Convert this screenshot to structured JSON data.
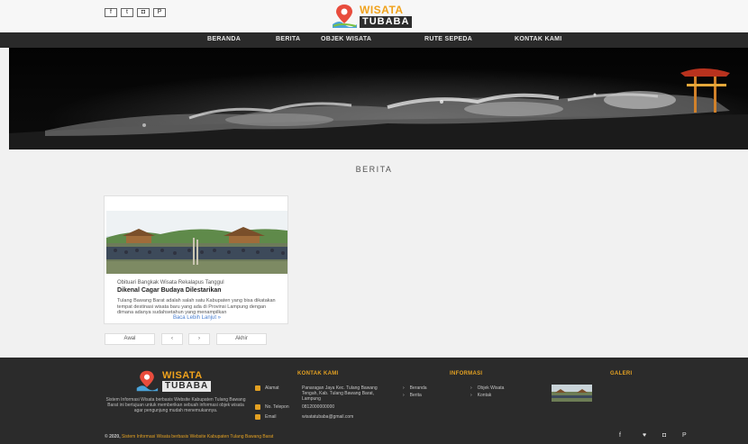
{
  "socials": [
    {
      "icon": "facebook-icon",
      "glyph": "f"
    },
    {
      "icon": "twitter-icon",
      "glyph": "t"
    },
    {
      "icon": "instagram-icon",
      "glyph": "◘"
    },
    {
      "icon": "pinterest-icon",
      "glyph": "P"
    }
  ],
  "logo": {
    "line1": "WISATA",
    "line2": "TUBABA"
  },
  "nav": [
    "BERANDA",
    "BERITA",
    "OBJEK WISATA",
    "RUTE SEPEDA",
    "KONTAK KAMI"
  ],
  "section_title": "BERITA",
  "card": {
    "title_small": "Obituari Bangkak Wisata Rekalapus Tanggul",
    "title": "Dikenal Cagar Budaya Dilestarikan",
    "text": "Tulang Bawang Barat adalah salah satu Kabupaten yang bisa dikatakan tempat destinasi wisata baru yang ada di Provinsi Lampung dengan dimana adanya sudahsetahun yang menampilkan",
    "link": "Baca Lebih Lanjut »"
  },
  "pager": {
    "first": "Awal",
    "prev": "‹",
    "next": "›",
    "last": "Akhir"
  },
  "footer": {
    "logo": {
      "line1": "WISATA",
      "line2": "TUBABA"
    },
    "description": "Sistem Informasi Wisata berbasis Website Kabupaten Tulang Bawang Barat ini bertujuan untuk memberikan sebuah informasi objek wisata agar pengunjung mudah menemukannya.",
    "contact": {
      "heading": "KONTAK KAMI",
      "address_label": "Alamat",
      "address": "Panaragan Jaya Kec. Tulang Bawang Tengah, Kab. Tulang Bawang Barat, Lampung",
      "phone_label": "No. Telepon",
      "phone": "0812000000000",
      "email_label": "Email",
      "email": "wisatatubaba@gmail.com"
    },
    "info": {
      "heading": "INFORMASI",
      "links": [
        "Beranda",
        "Objek Wisata",
        "Berita",
        "Kontak"
      ]
    },
    "gallery": {
      "heading": "GALERI"
    },
    "copyright_prefix": "© 2020,",
    "copyright_text": "Sistem Informasi Wisata berbasis Website Kabupaten Tulang Bawang Barat",
    "social_icons": [
      "facebook-icon",
      "twitter-icon",
      "instagram-icon",
      "pinterest-icon"
    ]
  }
}
